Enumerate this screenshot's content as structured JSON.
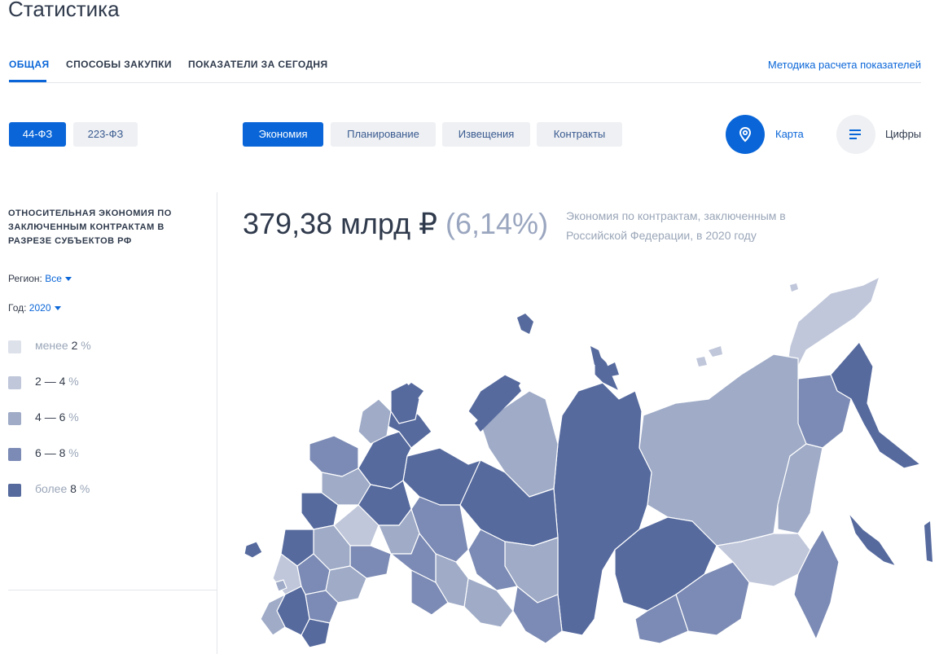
{
  "page": {
    "title": "Статистика"
  },
  "tabs": [
    {
      "label": "ОБЩАЯ",
      "active": true
    },
    {
      "label": "СПОСОБЫ ЗАКУПКИ",
      "active": false
    },
    {
      "label": "ПОКАЗАТЕЛИ ЗА СЕГОДНЯ",
      "active": false
    }
  ],
  "method_link": "Методика расчета показателей",
  "law_buttons": [
    {
      "label": "44-ФЗ",
      "active": true
    },
    {
      "label": "223-ФЗ",
      "active": false
    }
  ],
  "category_buttons": [
    {
      "label": "Экономия",
      "active": true
    },
    {
      "label": "Планирование",
      "active": false
    },
    {
      "label": "Извещения",
      "active": false
    },
    {
      "label": "Контракты",
      "active": false
    }
  ],
  "view_toggle": {
    "map": {
      "label": "Карта",
      "icon": "map-pin-icon",
      "active": true
    },
    "numbers": {
      "label": "Цифры",
      "icon": "list-icon",
      "active": false
    }
  },
  "sidebar": {
    "title": "ОТНОСИТЕЛЬНАЯ ЭКОНОМИЯ ПО ЗАКЛЮЧЕННЫМ КОНТРАКТАМ В РАЗРЕЗЕ СУБЪЕКТОВ РФ",
    "region": {
      "label": "Регион:",
      "value": "Все"
    },
    "year": {
      "label": "Год:",
      "value": "2020"
    },
    "legend": [
      {
        "prefix": "менее",
        "num_a": "2",
        "sep": "",
        "num_b": "",
        "unit": "%",
        "color": "#dde1ea"
      },
      {
        "prefix": "",
        "num_a": "2",
        "sep": "—",
        "num_b": "4",
        "unit": "%",
        "color": "#c0c7da"
      },
      {
        "prefix": "",
        "num_a": "4",
        "sep": "—",
        "num_b": "6",
        "unit": "%",
        "color": "#9fabc7"
      },
      {
        "prefix": "",
        "num_a": "6",
        "sep": "—",
        "num_b": "8",
        "unit": "%",
        "color": "#7c8bb5"
      },
      {
        "prefix": "более",
        "num_a": "8",
        "sep": "",
        "num_b": "",
        "unit": "%",
        "color": "#566a9e"
      }
    ]
  },
  "summary": {
    "value": "379,38 млрд ₽",
    "percent": "(6,14%)",
    "description": "Экономия по контрактам, заключенным в Российской Федерации, в 2020 году"
  },
  "colors": {
    "accent": "#0a66d8",
    "scale": [
      "#dde1ea",
      "#c0c7da",
      "#9fabc7",
      "#7c8bb5",
      "#566a9e"
    ]
  }
}
